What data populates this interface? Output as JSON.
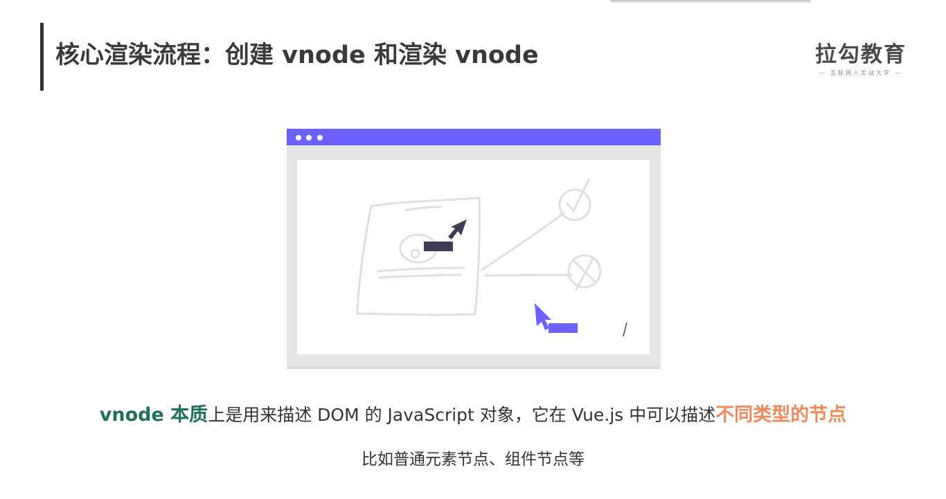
{
  "slide": {
    "title": "核心渲染流程：创建 vnode 和渲染 vnode",
    "logo": {
      "name": "拉勾教育",
      "tagline": "— 互联网人实战大学 —"
    },
    "caption": {
      "term": "vnode 本质",
      "middle": "上是用来描述 DOM 的 JavaScript 对象，它在 Vue.js 中可以描述",
      "highlight": "不同类型的节点"
    },
    "sub_caption": "比如普通元素节点、组件节点等"
  },
  "colors": {
    "browser_bar": "#6c63ff",
    "browser_frame": "#e6e6e6",
    "teal": "#1e6f5c",
    "orange": "#f08a5d",
    "dark_cursor": "#3f3d56",
    "sketch": "#e0e0e0"
  }
}
